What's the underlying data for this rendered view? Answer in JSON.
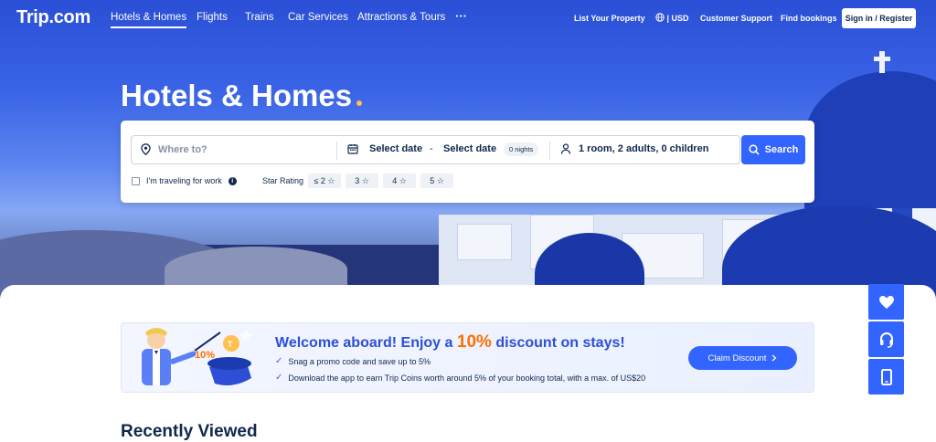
{
  "brand": {
    "logo": "Trip.com"
  },
  "nav": {
    "items": [
      {
        "label": "Hotels & Homes",
        "active": true
      },
      {
        "label": "Flights"
      },
      {
        "label": "Trains"
      },
      {
        "label": "Car Services"
      },
      {
        "label": "Attractions & Tours"
      },
      {
        "label": "···"
      }
    ],
    "right": {
      "list_property": "List Your Property",
      "currency": "| USD",
      "support": "Customer Support",
      "find_bookings": "Find bookings",
      "sign_in": "Sign in / Register"
    }
  },
  "hero": {
    "title": "Hotels & Homes"
  },
  "search": {
    "where_placeholder": "Where to?",
    "checkin": "Select date",
    "dash": "-",
    "checkout": "Select date",
    "nights": "0 nights",
    "guests": "1 room, 2 adults, 0 children",
    "button": "Search",
    "work_label": "I'm traveling for work",
    "star_label": "Star Rating",
    "star_chips": [
      "≤ 2 ☆",
      "3 ☆",
      "4 ☆",
      "5 ☆"
    ]
  },
  "promo": {
    "title_pre": "Welcome aboard! Enjoy a ",
    "title_pct": "10%",
    "title_post": " discount on stays!",
    "line1": "Snag a promo code and save up to 5%",
    "line2": "Download the app to earn Trip Coins worth around 5% of your booking total, with a max. of US$20",
    "claim": "Claim Discount",
    "art_text": "10%"
  },
  "recent": {
    "title": "Recently Viewed"
  },
  "colors": {
    "primary": "#3264ff",
    "accent": "#ff6f00",
    "text": "#0f294d"
  }
}
